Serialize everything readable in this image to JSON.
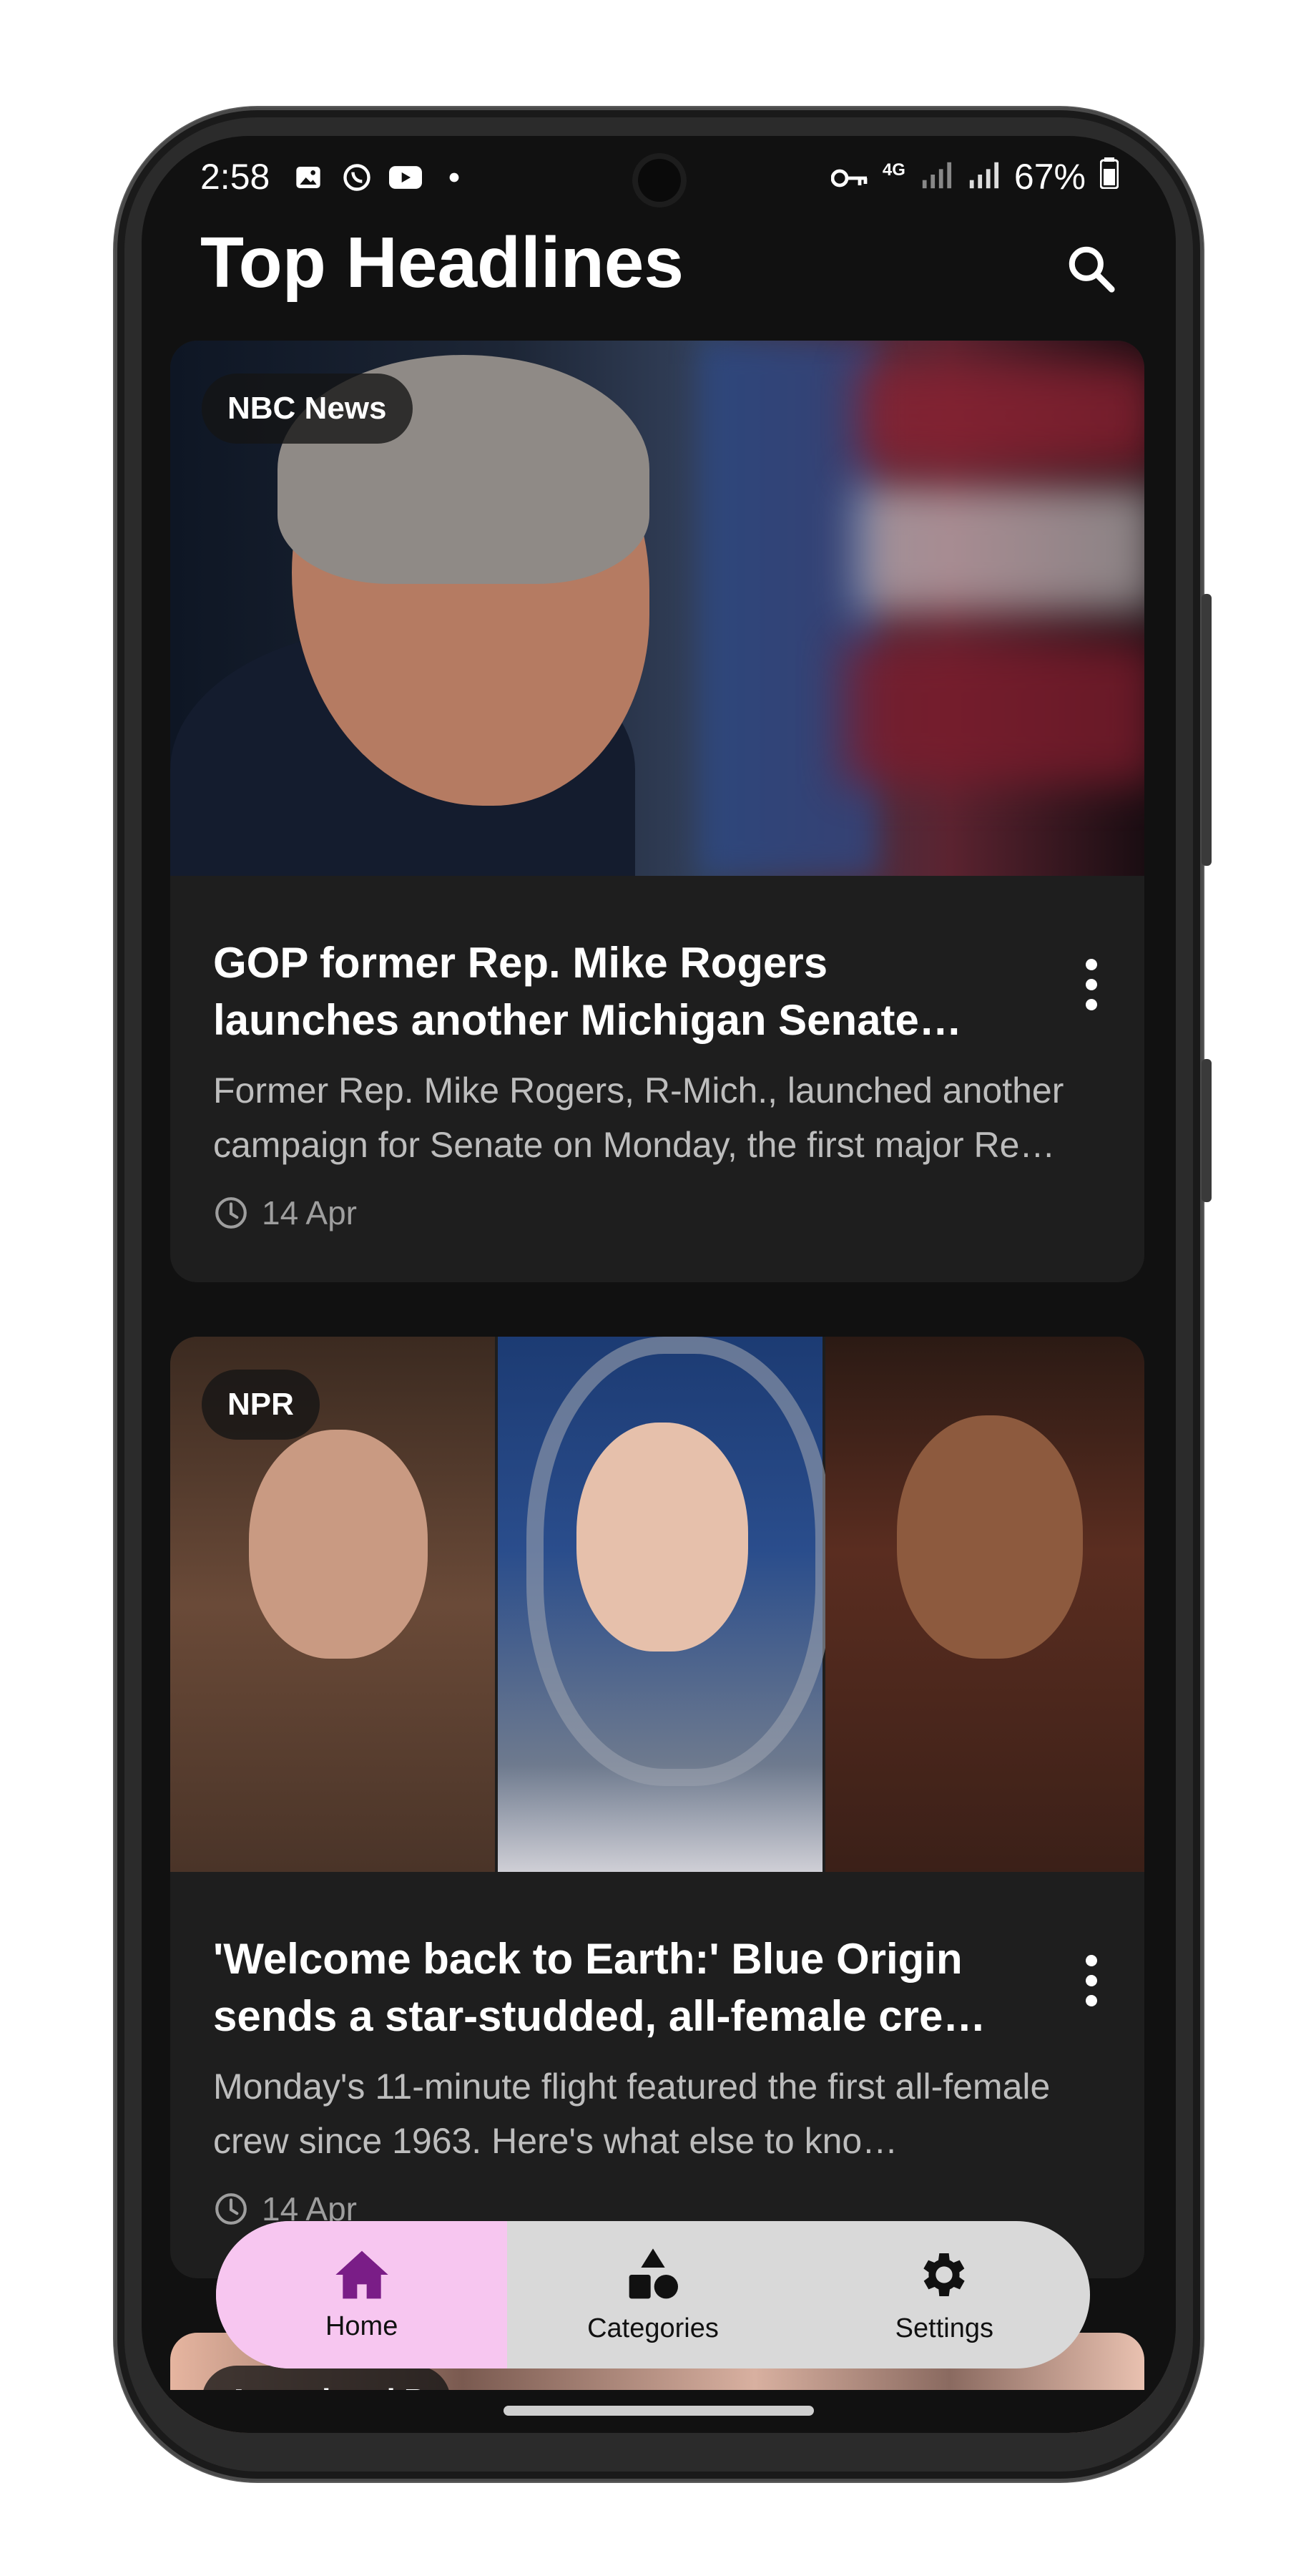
{
  "status_bar": {
    "time": "2:58",
    "network": "4G",
    "battery": "67%"
  },
  "app_bar": {
    "title": "Top Headlines",
    "search_icon": "search-icon"
  },
  "articles": [
    {
      "source": "NBC News",
      "title": "GOP former Rep. Mike Rogers launches another Michigan Senate ru…",
      "description": "Former Rep. Mike Rogers, R-Mich., launched another campaign for Senate on Monday, the first major Re…",
      "date": "14 Apr"
    },
    {
      "source": "NPR",
      "title": "'Welcome back to Earth:' Blue Origin sends a star-studded, all-female cre…",
      "description": "Monday's 11-minute flight featured the first all-female crew since 1963. Here's what else to kno…",
      "date": "14 Apr"
    },
    {
      "source": "Associated P"
    }
  ],
  "bottom_nav": {
    "items": [
      {
        "label": "Home",
        "icon": "home-icon",
        "active": true
      },
      {
        "label": "Categories",
        "icon": "categories-icon",
        "active": false
      },
      {
        "label": "Settings",
        "icon": "settings-icon",
        "active": false
      }
    ]
  },
  "colors": {
    "background": "#111111",
    "card": "#1e1e1e",
    "nav_bar": "#d9d9d9",
    "nav_active": "#f7c6f0",
    "home_icon": "#7a1d87"
  }
}
